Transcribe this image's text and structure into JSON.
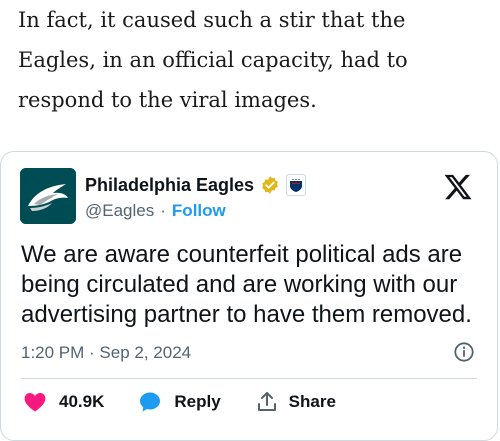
{
  "article": {
    "paragraph": "In fact, it caused such a stir that the Eagles, in an official capacity, had to respond to the viral images."
  },
  "tweet": {
    "display_name": "Philadelphia Eagles",
    "handle": "@Eagles",
    "separator": "·",
    "follow_label": "Follow",
    "text": "We are aware counterfeit political ads are being circulated and are working with our advertising partner to have them removed.",
    "timestamp": "1:20 PM · Sep 2, 2024",
    "actions": {
      "likes_count": "40.9K",
      "reply_label": "Reply",
      "share_label": "Share"
    },
    "colors": {
      "like": "#f91880",
      "reply": "#1d9bf0",
      "follow": "#1d9bf0",
      "verified": "#e2b719",
      "avatar_bg": "#004c54"
    }
  },
  "icons": {
    "verified": "verified-badge-icon",
    "affiliate": "nfl-affiliate-icon",
    "platform": "x-logo-icon",
    "info": "info-icon",
    "like": "heart-icon",
    "reply": "reply-bubble-icon",
    "share": "share-icon"
  }
}
